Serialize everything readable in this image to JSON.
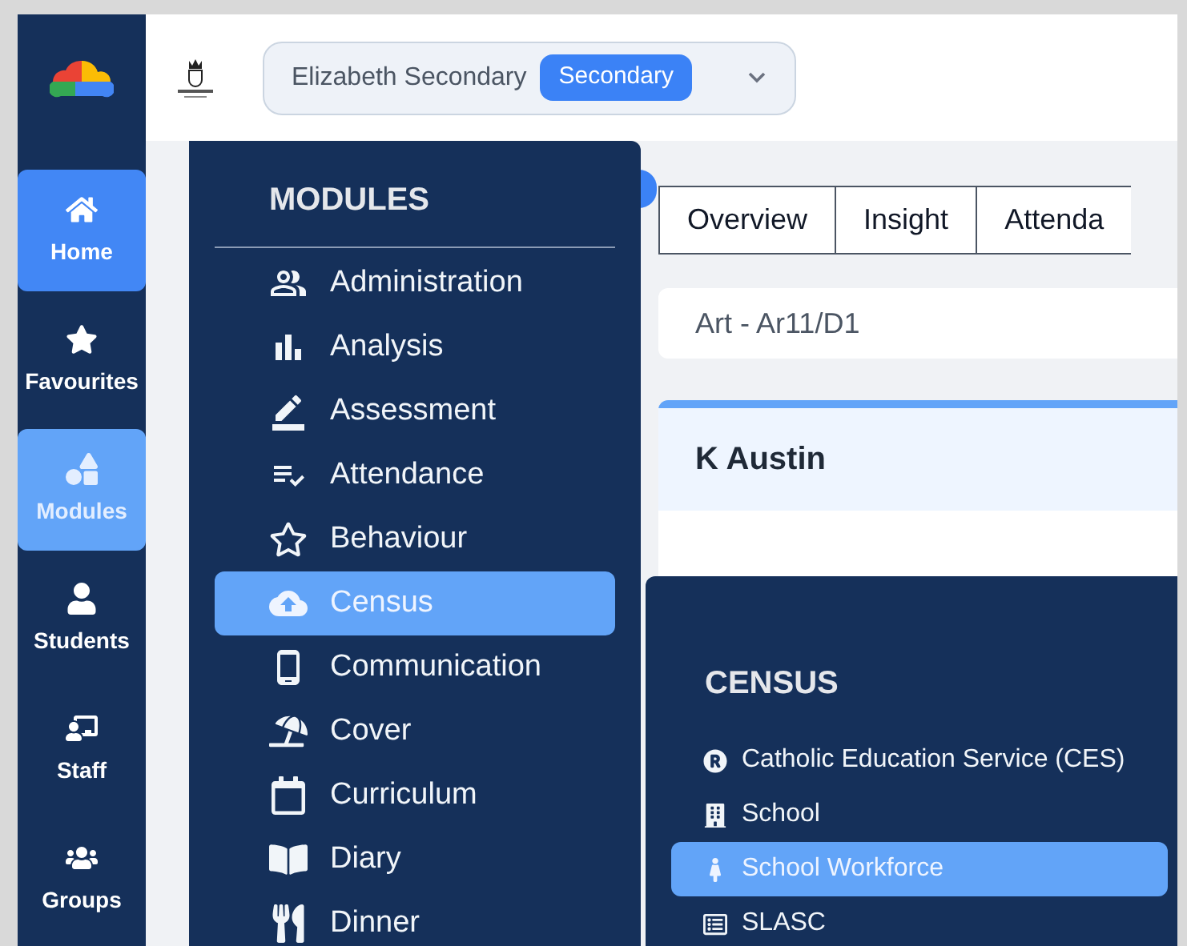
{
  "header": {
    "school": "Elizabeth Secondary",
    "badge": "Secondary"
  },
  "nav": [
    {
      "label": "Home",
      "selected": true,
      "open": false
    },
    {
      "label": "Favourites",
      "selected": false,
      "open": false
    },
    {
      "label": "Modules",
      "selected": false,
      "open": true
    },
    {
      "label": "Students",
      "selected": false,
      "open": false
    },
    {
      "label": "Staff",
      "selected": false,
      "open": false
    },
    {
      "label": "Groups",
      "selected": false,
      "open": false
    }
  ],
  "tabs": [
    {
      "label": "Overview"
    },
    {
      "label": "Insight"
    },
    {
      "label": "Attenda"
    }
  ],
  "class_field": {
    "value": "Art - Ar11/D1"
  },
  "card": {
    "title": "K Austin"
  },
  "modules_menu": {
    "title": "MODULES",
    "items": [
      {
        "label": "Administration",
        "selected": false
      },
      {
        "label": "Analysis",
        "selected": false
      },
      {
        "label": "Assessment",
        "selected": false
      },
      {
        "label": "Attendance",
        "selected": false
      },
      {
        "label": "Behaviour",
        "selected": false
      },
      {
        "label": "Census",
        "selected": true
      },
      {
        "label": "Communication",
        "selected": false
      },
      {
        "label": "Cover",
        "selected": false
      },
      {
        "label": "Curriculum",
        "selected": false
      },
      {
        "label": "Diary",
        "selected": false
      },
      {
        "label": "Dinner",
        "selected": false
      }
    ]
  },
  "census_menu": {
    "title": "CENSUS",
    "items": [
      {
        "label": "Catholic Education Service (CES)",
        "selected": false
      },
      {
        "label": "School",
        "selected": false
      },
      {
        "label": "School Workforce",
        "selected": true
      },
      {
        "label": "SLASC",
        "selected": false
      }
    ]
  }
}
